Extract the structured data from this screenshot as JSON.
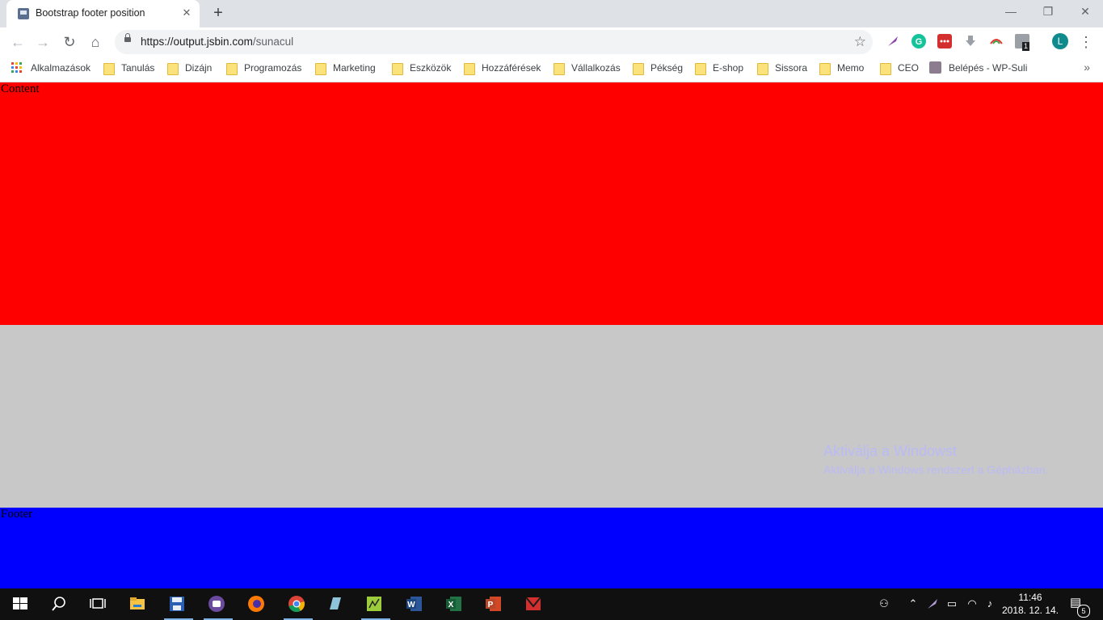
{
  "browser": {
    "tab_title": "Bootstrap footer position",
    "tab_close": "✕",
    "new_tab": "+",
    "url_host": "https://output.jsbin.com",
    "url_path": "/sunacul",
    "profile_initial": "L",
    "extension_badge": "1",
    "window_controls": {
      "minimize": "—",
      "maximize": "❐",
      "close": "✕"
    }
  },
  "bookmarks": {
    "apps_label": "Alkalmazások",
    "items": [
      {
        "label": "Tanulás"
      },
      {
        "label": "Dizájn"
      },
      {
        "label": "Programozás"
      },
      {
        "label": "Marketing"
      },
      {
        "label": "Eszközök"
      },
      {
        "label": "Hozzáférések"
      },
      {
        "label": "Vállalkozás"
      },
      {
        "label": "Pékség"
      },
      {
        "label": "E-shop"
      },
      {
        "label": "Sissora"
      },
      {
        "label": "Memo"
      },
      {
        "label": "CEO"
      }
    ],
    "wp_label": "Belépés - WP-Suli",
    "more": "»"
  },
  "page": {
    "content_label": "Content",
    "footer_label": "Footer",
    "colors": {
      "content": "#ff0000",
      "middle": "#c8c8c8",
      "footer": "#0000ff"
    }
  },
  "watermark": {
    "title": "Aktiválja a Windowst",
    "subtitle": "Aktiválja a Windows rendszert a Gépházban."
  },
  "taskbar": {
    "time": "11:46",
    "date": "2018. 12. 14.",
    "notification_count": "5"
  }
}
